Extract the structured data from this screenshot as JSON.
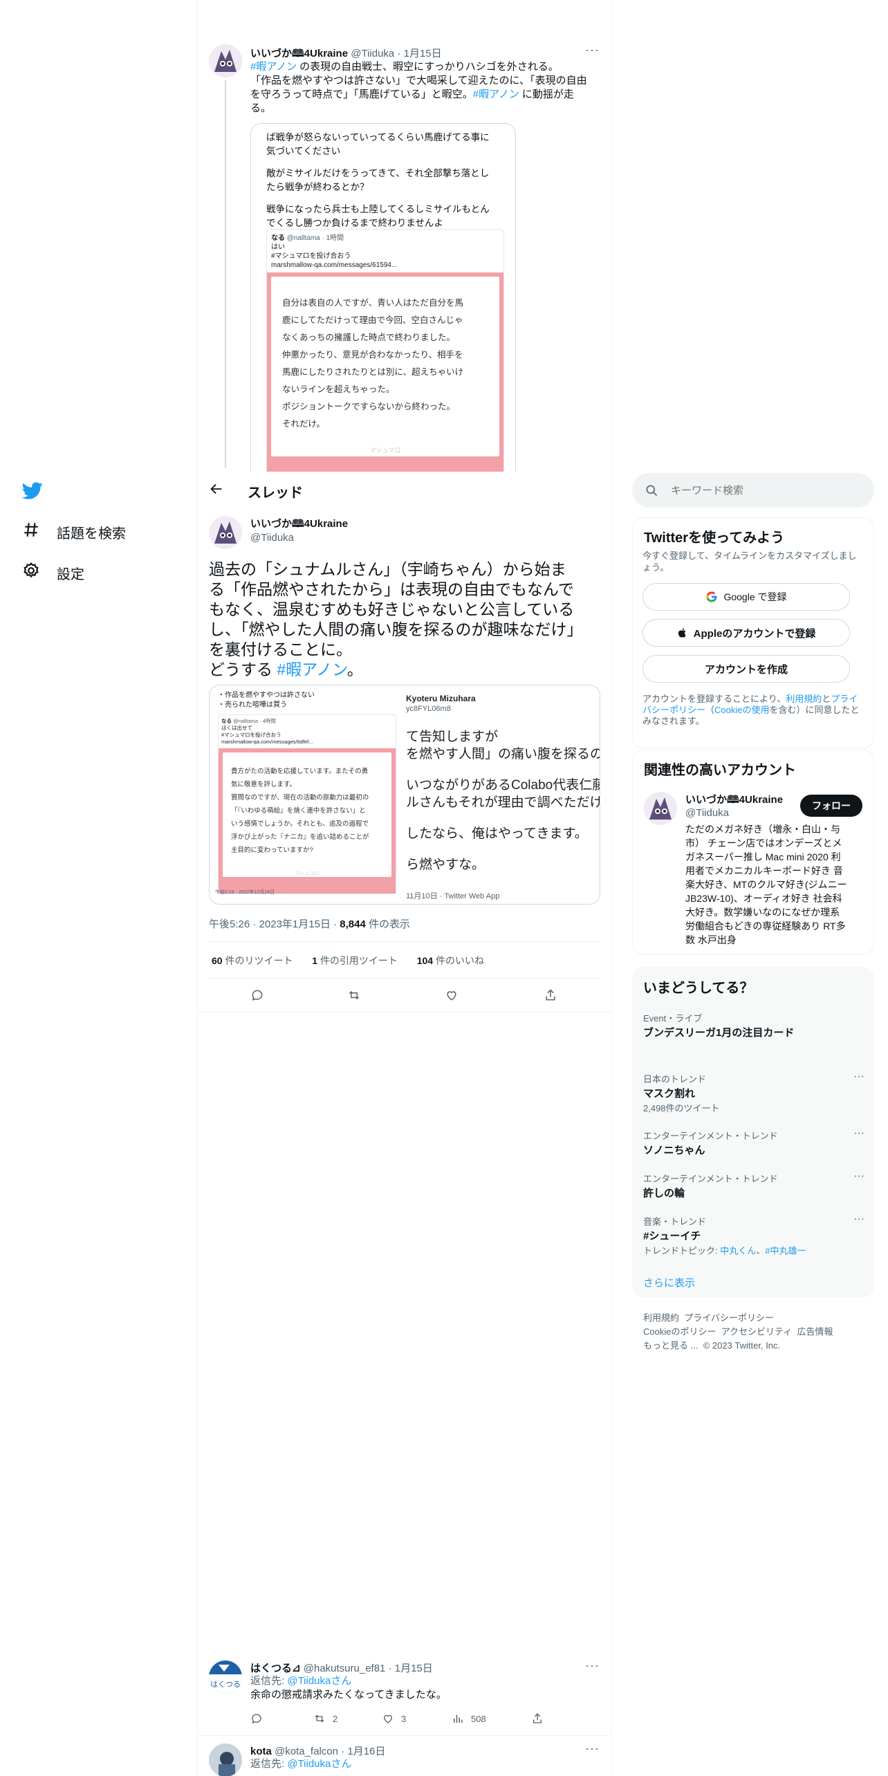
{
  "nav": {
    "explore": "話題を検索",
    "settings": "設定"
  },
  "header": {
    "title": "スレッド"
  },
  "quoted_tweet": {
    "display_name": "いいづか🕮4Ukraine",
    "handle": "@Tiiduka",
    "date": "1月15日",
    "line1_hashtag": "#暇アノン",
    "line1_rest": " の表現の自由戦士、暇空にすっかりハシゴを外される。",
    "line2": "「作品を燃やすやつは許さない」で大喝采して迎えたのに、「表現の自由",
    "line3_a": "を守ろうって時点で」「馬鹿げている」と暇空。",
    "line3_hashtag": "#暇アノン",
    "line3_b": " に動揺が走",
    "line4": "る。",
    "image": {
      "top_text1": "ば戦争が怒らないっていってるくらい馬鹿げてる事に",
      "top_text2": "気づいてください",
      "mid_text1": "敵がミサイルだけをうってきて、それ全部撃ち落とし",
      "mid_text2": "たら戦争が終わるとか？",
      "low_text1": "戦争になったら兵士も上陸してくるしミサイルもとん",
      "low_text2": "でくるし勝つか負けるまで終わりませんよ",
      "inner_name": "なる",
      "inner_handle": "@nalltama · 1時間",
      "inner_l1": "はい",
      "inner_l2": "#マシュマロを投げ合おう",
      "inner_l3": "marshmallow-qa.com/messages/61594...",
      "box_l1": "自分は表自の人ですが、青い人はただ自分を馬",
      "box_l2": "鹿にしてただけって理由で今回、空白さんじゃ",
      "box_l3": "なくあっちの擁護した時点で終わりました。",
      "box_l4": "仲悪かったり、意見が合わなかったり、相手を",
      "box_l5": "馬鹿にしたりされたりとは別に、超えちゃいけ",
      "box_l6": "ないラインを超えちゃった。",
      "box_l7": "ポジショントークですらないから終わった。",
      "box_l8": "それだけ。",
      "watermark": "マシュマロ"
    }
  },
  "main_tweet": {
    "display_name": "いいづか🕮4Ukraine",
    "handle": "@Tiiduka",
    "text_l1": "過去の「シュナムルさん」（宇崎ちゃん）から始ま",
    "text_l2": "る「作品燃やされたから」は表現の自由でもなんで",
    "text_l3": "もなく、温泉むすめも好きじゃないと公言している",
    "text_l4": "し、「燃やした人間の痛い腹を探るのが趣味なだけ」",
    "text_l5": "を裏付けることに。",
    "text_l6_a": "どうする ",
    "text_l6_hashtag": "#暇アノン",
    "text_l6_b": "。",
    "image": {
      "top1": "・作品を燃やすやつは許さない",
      "top2": "・売られた喧嘩は買う",
      "inner_name": "なる",
      "inner_handle": "@nalltama · 4時間",
      "inner_l1": "ほくは出せて",
      "inner_l2": "#マシュマロを投げ合おう",
      "inner_l3": "marshmallow-qa.com/messages/6dfef...",
      "box_l1": "貴方がたの活動を応援しています。またその勇",
      "box_l2": "気に敬意を評します。",
      "box_l3": "質問なのですが、現在の活動の原動力は最初の",
      "box_l4": "「『いわゆる萌絵』を焼く連中を許さない」と",
      "box_l5": "いう感情でしょうか。それとも、追及の過程で",
      "box_l6": "浮かび上がった『ナニカ』を追い詰めることが",
      "box_l7": "主目的に変わっていますか?",
      "watermark": "マシュマロ",
      "footer_left": "午前2:19 · 2022年12月24日",
      "right_name": "Kyoteru Mizuhara",
      "right_handle": "yc8FYL06m8",
      "right_l1": "て告知しますが",
      "right_l2": "を燃やす人間」の痛い腹を探るの",
      "right_l3": "いつながりがあるColabo代表仁藤",
      "right_l4": "ルさんもそれが理由で調べただけ",
      "right_l5": "したなら、俺はやってきます。",
      "right_l6": "ら燃やすな。",
      "right_footer": "11月10日 · Twitter Web App"
    },
    "time": "午後5:26",
    "date": "2023年1月15日",
    "views_count": "8,844",
    "views_label": "件の表示",
    "retweets_count": "60",
    "retweets_label": "件のリツイート",
    "quotes_count": "1",
    "quotes_label": "件の引用ツイート",
    "likes_count": "104",
    "likes_label": "件のいいね"
  },
  "replies": [
    {
      "display_name": "はくつる⊿",
      "handle": "@hakutsuru_ef81",
      "date": "1月15日",
      "reply_to_label": "返信先: ",
      "reply_to": "@Tiidukaさん",
      "text": "余命の懲戒請求みたくなってきましたな。",
      "retweets": "2",
      "likes": "3",
      "views": "508",
      "avatar_text": "はくつる"
    },
    {
      "display_name": "kota",
      "handle": "@kota_falcon",
      "date": "1月16日",
      "reply_to_label": "返信先: ",
      "reply_to": "@Tiidukaさん"
    }
  ],
  "sidebar": {
    "search_placeholder": "キーワード検索",
    "signup": {
      "title": "Twitterを使ってみよう",
      "subtitle": "今すぐ登録して、タイムラインをカスタマイズしましょう。",
      "google_btn": "Google で登録",
      "apple_btn": "Appleのアカウントで登録",
      "create_btn": "アカウントを作成",
      "terms_a": "アカウントを登録することにより、",
      "terms_link1": "利用規約",
      "terms_b": "と",
      "terms_link2": "プライバシーポリシー",
      "terms_c": "（",
      "terms_link3": "Cookieの使用",
      "terms_d": "を含む）に同意したとみなされます。"
    },
    "related": {
      "title": "関連性の高いアカウント",
      "display_name": "いいづか🕮4Ukraine",
      "handle": "@Tiiduka",
      "follow_btn": "フォロー",
      "bio_l1": "ただのメガネ好き（増永・白山・与",
      "bio_l2": "市） チェーン店ではオンデーズとメ",
      "bio_l3": "ガネスーパー推し Mac mini 2020 利",
      "bio_l4": "用者でメカニカルキーボード好き 音",
      "bio_l5": "楽大好き、MTのクルマ好き(ジムニー",
      "bio_l6": "JB23W-10)、オーディオ好き 社会科",
      "bio_l7": "大好き。数学嫌いなのになぜか理系",
      "bio_l8": "労働組合もどきの専従経験あり RT多",
      "bio_l9": "数 水戸出身"
    },
    "trends": {
      "title": "いまどうしてる？",
      "items": [
        {
          "category": "Event・ライブ",
          "name": "ブンデスリーガ1月の注目カード"
        },
        {
          "category": "日本のトレンド",
          "name": "マスク割れ",
          "count": "2,498件のツイート"
        },
        {
          "category": "エンターテインメント・トレンド",
          "name": "ソノニちゃん"
        },
        {
          "category": "エンターテインメント・トレンド",
          "name": "許しの輪"
        },
        {
          "category": "音楽・トレンド",
          "name": "#シューイチ",
          "topic_label": "トレンドトピック: ",
          "topic_a": "中丸くん",
          "topic_sep": "、",
          "topic_b": "#中丸雄一"
        }
      ],
      "show_more": "さらに表示"
    },
    "footer": {
      "l1_a": "利用規約",
      "l1_b": "プライバシーポリシー",
      "l2_a": "Cookieのポリシー",
      "l2_b": "アクセシビリティ",
      "l2_c": "広告情報",
      "l3_a": "もっと見る ...",
      "l3_b": "© 2023 Twitter, Inc."
    }
  }
}
